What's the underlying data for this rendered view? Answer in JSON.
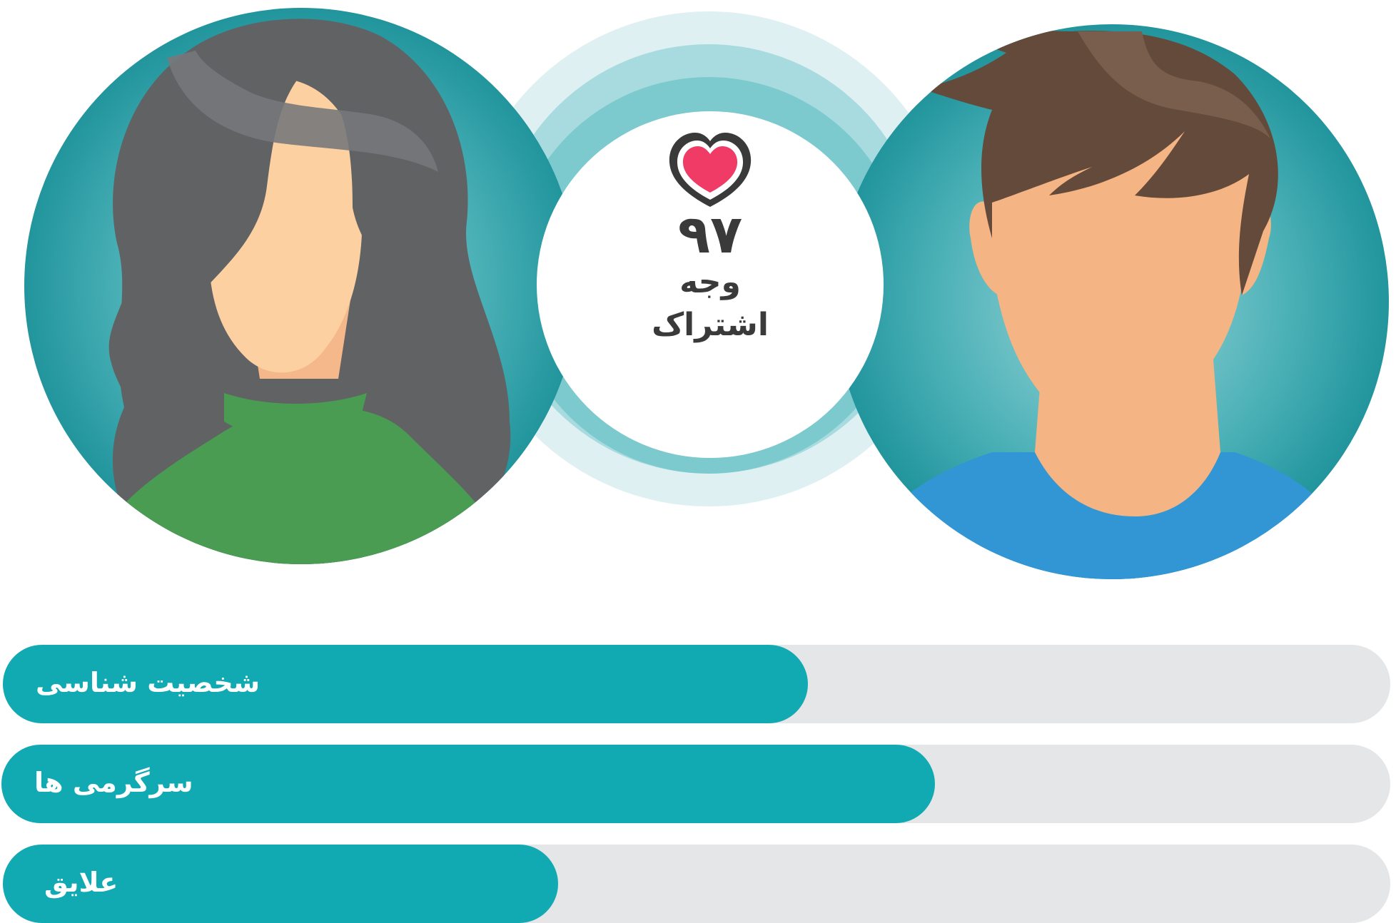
{
  "match": {
    "score": "۹۷",
    "label_line1": "وجه",
    "label_line2": "اشتراک",
    "icon": "heart-icon",
    "heart_color": "#ef3b66"
  },
  "avatars": {
    "left": {
      "icon": "female-avatar-icon"
    },
    "right": {
      "icon": "male-avatar-icon"
    }
  },
  "categories": [
    {
      "label": "شخصیت شناسی",
      "fill_fraction": 0.58
    },
    {
      "label": "سرگرمی ها",
      "fill_fraction": 0.672
    },
    {
      "label": "علایق",
      "fill_fraction": 0.4
    }
  ],
  "colors": {
    "bar_fill": "#12aab2",
    "bar_track": "#e4e6e8",
    "accent": "#0f7f88"
  }
}
